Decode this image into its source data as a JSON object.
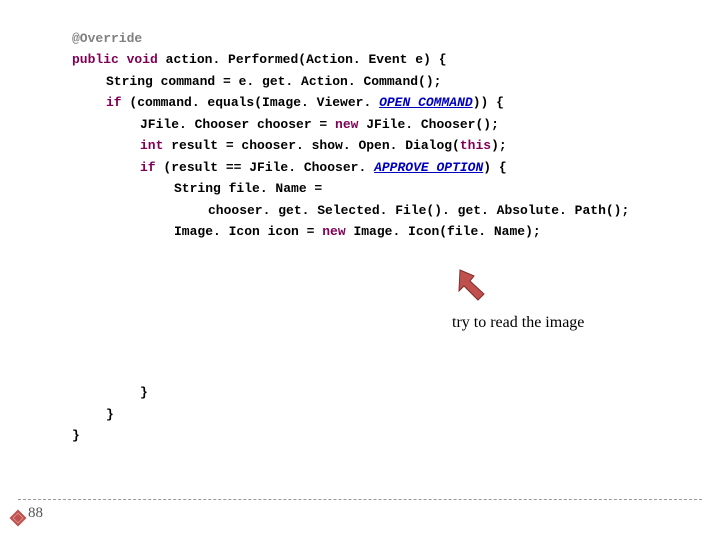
{
  "code": {
    "l1_annotation": "@Override",
    "l2_a": "public",
    "l2_b": "void",
    "l2_c": " action. Performed(Action. Event e) {",
    "l3": "String command = e. get. Action. Command();",
    "l4_a": "if",
    "l4_b": " (command. equals(Image. Viewer.",
    "l4_c": "OPEN_COMMAND",
    "l4_d": ")) {",
    "l5_a": "JFile. Chooser chooser = ",
    "l5_b": "new",
    "l5_c": " JFile. Chooser();",
    "l6_a": "int",
    "l6_b": " result = chooser. show. Open. Dialog(",
    "l6_c": "this",
    "l6_d": ");",
    "l7_a": "if",
    "l7_b": " (result == JFile. Chooser.",
    "l7_c": "APPROVE_OPTION",
    "l7_d": ") {",
    "l8": "String file. Name =",
    "l9": "chooser. get. Selected. File(). get. Absolute. Path();",
    "l10_a": "Image. Icon icon = ",
    "l10_b": "new",
    "l10_c": " Image. Icon(file. Name);",
    "l11": "}",
    "l12": "}",
    "l13": "}"
  },
  "callout": "try to read the image",
  "arrow_color": "#c0504d",
  "page_number": "88"
}
